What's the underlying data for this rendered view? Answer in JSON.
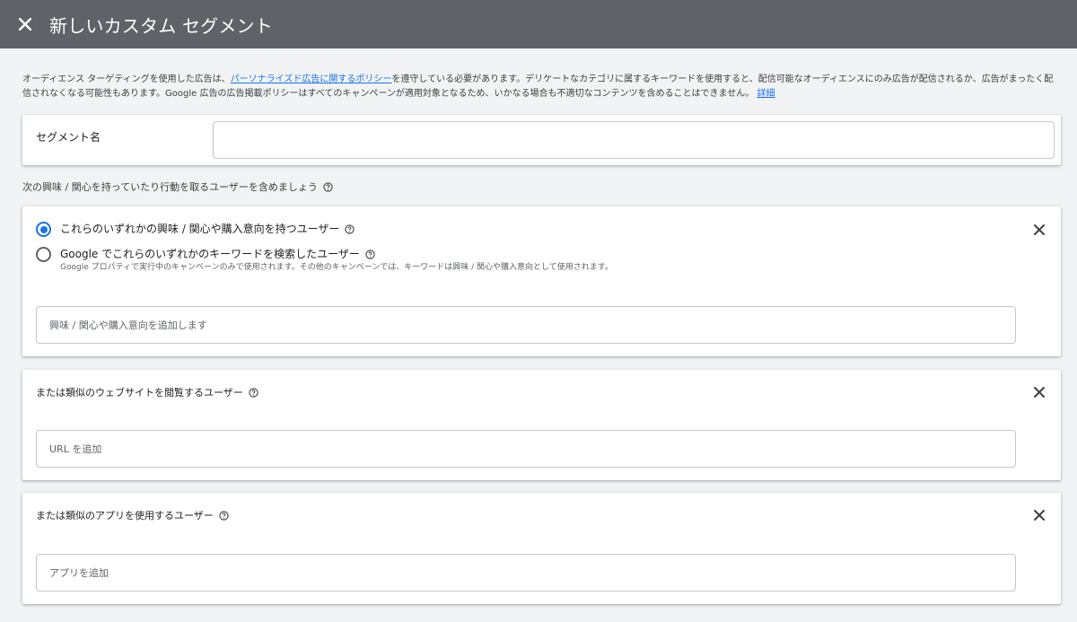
{
  "header": {
    "title": "新しいカスタム セグメント",
    "close_icon": "close-icon"
  },
  "notice": {
    "text_before": "オーディエンス ターゲティングを使用した広告は、",
    "policy_link": "パーソナライズド広告に関するポリシー",
    "text_after": "を遵守している必要があります。デリケートなカテゴリに属するキーワードを使用すると、配信可能なオーディエンスにのみ広告が配信されるか、広告がまったく配信されなくなる可能性もあります。Google 広告の広告掲載ポリシーはすべてのキャンペーンが適用対象となるため、いかなる場合も不適切なコンテンツを含めることはできません。",
    "details_link": "詳細"
  },
  "segment_name": {
    "label": "セグメント名",
    "value": ""
  },
  "include_label": "次の興味 / 関心を持っていたり行動を取るユーザーを含めましょう",
  "interest_card": {
    "option1": "これらのいずれかの興味 / 関心や購入意向を持つユーザー",
    "option2": "Google でこれらのいずれかのキーワードを検索したユーザー",
    "option2_note": "Google プロパティで実行中のキャンペーンのみで使用されます。その他のキャンペーンでは、キーワードは興味 / 関心や購入意向として使用されます。",
    "selected": "option1",
    "input_placeholder": "興味 / 関心や購入意向を追加します"
  },
  "website_card": {
    "title": "または類似のウェブサイトを閲覧するユーザー",
    "input_placeholder": "URL を追加"
  },
  "app_card": {
    "title": "または類似のアプリを使用するユーザー",
    "input_placeholder": "アプリを追加"
  },
  "colors": {
    "header_bg": "#5f6368",
    "page_bg": "#f1f3f4",
    "accent": "#1a73e8"
  }
}
